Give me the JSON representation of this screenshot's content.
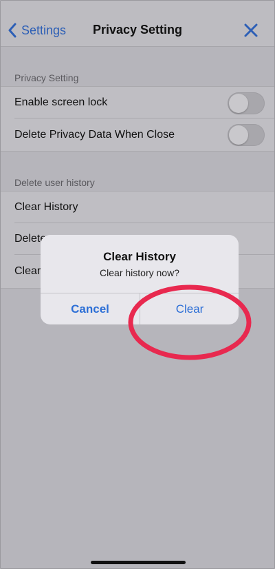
{
  "nav": {
    "back_label": "Settings",
    "title": "Privacy Setting"
  },
  "sections": [
    {
      "header": "Privacy Setting",
      "items": [
        {
          "label": "Enable screen lock",
          "toggle": false
        },
        {
          "label": "Delete Privacy Data When Close",
          "toggle": false
        }
      ]
    },
    {
      "header": "Delete user history",
      "items": [
        {
          "label": "Clear History"
        },
        {
          "label": "Delete"
        },
        {
          "label": "Clear"
        }
      ]
    }
  ],
  "dialog": {
    "title": "Clear History",
    "message": "Clear history now?",
    "cancel_label": "Cancel",
    "confirm_label": "Clear"
  },
  "colors": {
    "accent": "#2d6fd6",
    "annotation": "#e8294f"
  },
  "icons": {
    "back": "chevron-left-icon",
    "close": "close-icon"
  }
}
